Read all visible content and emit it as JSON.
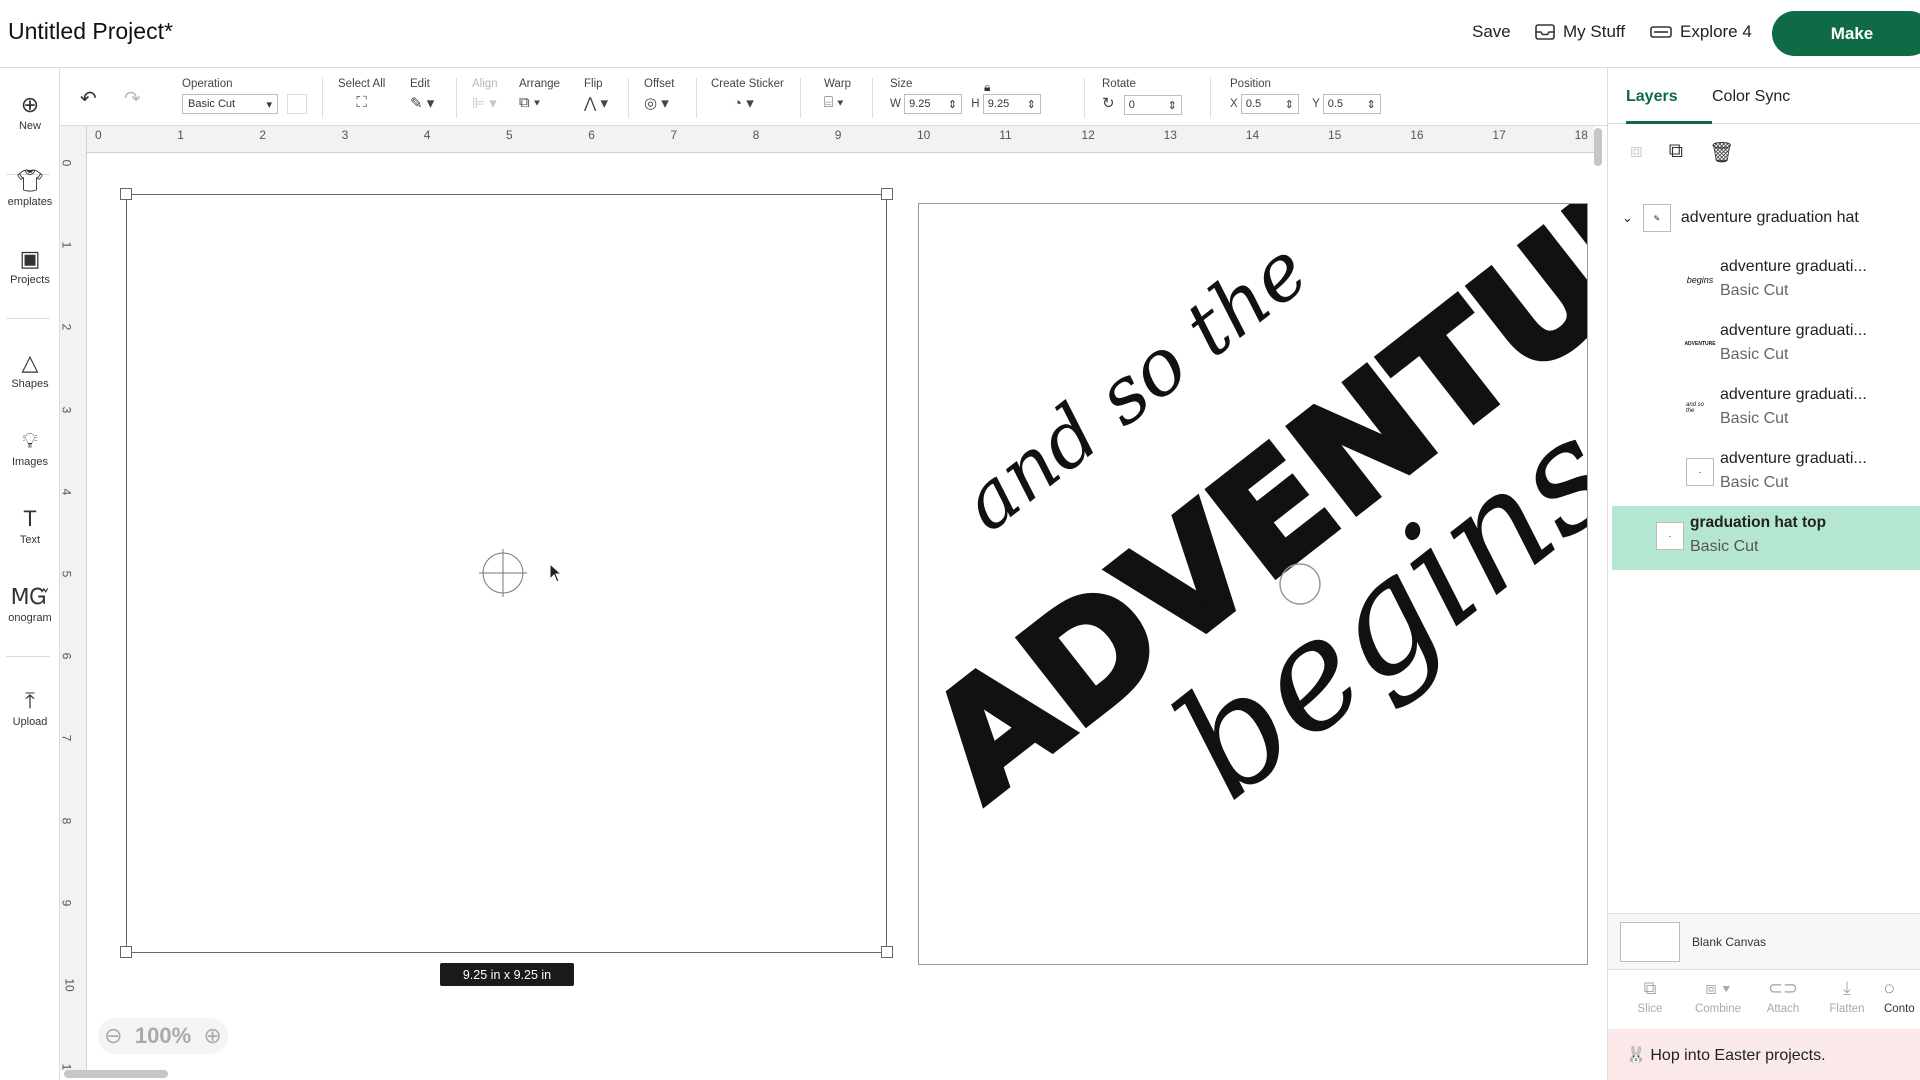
{
  "header": {
    "title": "Untitled Project*",
    "save_label": "Save",
    "my_stuff_label": "My Stuff",
    "explore_label": "Explore 4",
    "make_label": "Make"
  },
  "toolbar": {
    "operation_label": "Operation",
    "operation_value": "Basic Cut",
    "select_all_label": "Select All",
    "edit_label": "Edit",
    "align_label": "Align",
    "arrange_label": "Arrange",
    "flip_label": "Flip",
    "offset_label": "Offset",
    "create_sticker_label": "Create Sticker",
    "warp_label": "Warp",
    "size_label": "Size",
    "w_label": "W",
    "w_value": "9.25",
    "h_label": "H",
    "h_value": "9.25",
    "rotate_label": "Rotate",
    "rotate_value": "0",
    "position_label": "Position",
    "x_label": "X",
    "x_value": "0.5",
    "y_label": "Y",
    "y_value": "0.5"
  },
  "leftbar": {
    "items": [
      {
        "label": "New",
        "icon": "plus-circle-icon"
      },
      {
        "label": "emplates",
        "icon": "tshirt-icon"
      },
      {
        "label": "Projects",
        "icon": "projects-icon"
      },
      {
        "label": "Shapes",
        "icon": "shapes-icon"
      },
      {
        "label": "Images",
        "icon": "lightbulb-icon"
      },
      {
        "label": "Text",
        "icon": "text-icon"
      },
      {
        "label": "onogram",
        "icon": "monogram-icon"
      },
      {
        "label": "Upload",
        "icon": "upload-icon"
      }
    ]
  },
  "ruler": {
    "top": [
      "0",
      "1",
      "2",
      "3",
      "4",
      "5",
      "6",
      "7",
      "8",
      "9",
      "10",
      "11",
      "12",
      "13",
      "14",
      "15",
      "16",
      "17",
      "18"
    ],
    "left": [
      "0",
      "1",
      "2",
      "3",
      "4",
      "5",
      "6",
      "7",
      "8",
      "9",
      "10",
      "1"
    ]
  },
  "canvas": {
    "size_tooltip": "9.25  in x 9.25  in",
    "zoom_value": "100%",
    "design_text": [
      "and so the",
      "ADVENTURE",
      "begins"
    ]
  },
  "rightpanel": {
    "tabs": [
      "Layers",
      "Color Sync"
    ],
    "group_name": "adventure graduation hat",
    "layers": [
      {
        "name": "adventure graduati...",
        "type": "Basic Cut",
        "thumb": "begins"
      },
      {
        "name": "adventure graduati...",
        "type": "Basic Cut",
        "thumb": "ADVENTURE"
      },
      {
        "name": "adventure graduati...",
        "type": "Basic Cut",
        "thumb": "and so the"
      },
      {
        "name": "adventure graduati...",
        "type": "Basic Cut",
        "thumb": "·"
      },
      {
        "name": "graduation hat top",
        "type": "Basic Cut",
        "thumb": "·"
      }
    ],
    "blank_canvas_label": "Blank Canvas",
    "actions": [
      "Slice",
      "Combine",
      "Attach",
      "Flatten",
      "Conto"
    ],
    "banner": "🐰 Hop into Easter projects."
  },
  "colors": {
    "brand": "#0e6b45",
    "selected_layer": "#b5e6d2",
    "banner": "#fbe9ea"
  }
}
